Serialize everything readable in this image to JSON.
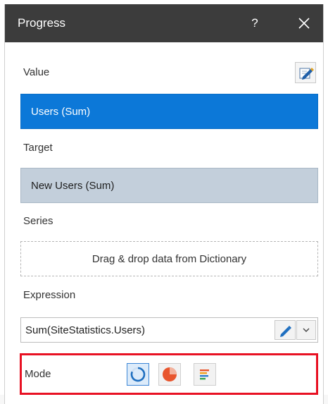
{
  "window": {
    "title": "Progress",
    "help_label": "?"
  },
  "value": {
    "label": "Value",
    "item": "Users (Sum)"
  },
  "target": {
    "label": "Target",
    "item": "New Users (Sum)"
  },
  "series": {
    "label": "Series",
    "placeholder": "Drag & drop data from Dictionary"
  },
  "expression": {
    "label": "Expression",
    "value": "Sum(SiteStatistics.Users)"
  },
  "mode": {
    "label": "Mode",
    "options": [
      "ring-mode-icon",
      "pie-mode-icon",
      "bars-mode-icon"
    ],
    "selected": "ring-mode-icon"
  },
  "colors": {
    "selection": "#0c78d8",
    "target_bg": "#c3cfdb",
    "highlight": "#e81123",
    "pie": "#e8552d"
  }
}
